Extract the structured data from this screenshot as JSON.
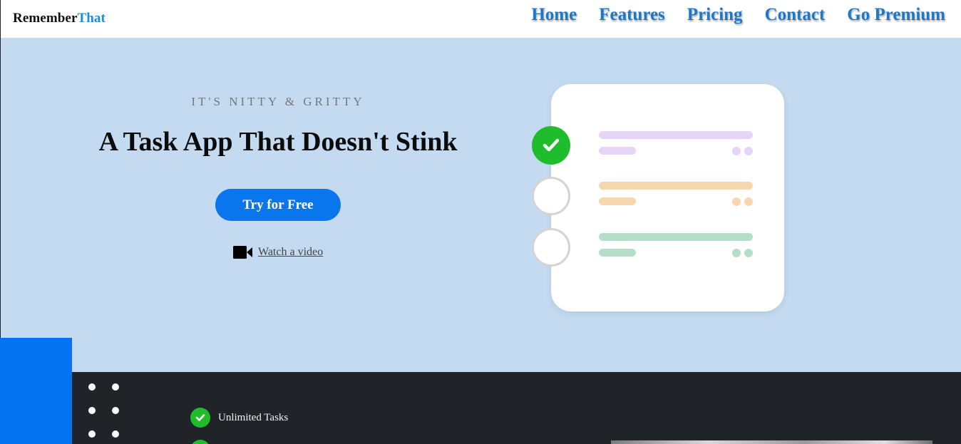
{
  "brand": {
    "name_part1": "Remember",
    "name_part2": "That",
    "accent_color": "#1a8cd8"
  },
  "nav": {
    "items": [
      {
        "label": "Home"
      },
      {
        "label": "Features"
      },
      {
        "label": "Pricing"
      },
      {
        "label": "Contact"
      },
      {
        "label": "Go Premium"
      }
    ]
  },
  "hero": {
    "eyebrow": "IT'S NITTY & GRITTY",
    "headline": "A Task App That Doesn't Stink",
    "cta_label": "Try for Free",
    "video_link_label": "Watch a video",
    "video_icon": "video-camera-icon",
    "background_color": "#c3daf0"
  },
  "illustration": {
    "tasks": [
      {
        "state": "done",
        "color": "#e6d5f7"
      },
      {
        "state": "todo",
        "color": "#f9d7ae"
      },
      {
        "state": "todo",
        "color": "#b5dec9"
      }
    ]
  },
  "features": {
    "items": [
      {
        "label": "Unlimited Tasks",
        "icon": "check-circle-icon"
      }
    ]
  },
  "colors": {
    "primary": "#0a76ee",
    "success": "#1fbd2c",
    "dark_section": "#202429"
  }
}
